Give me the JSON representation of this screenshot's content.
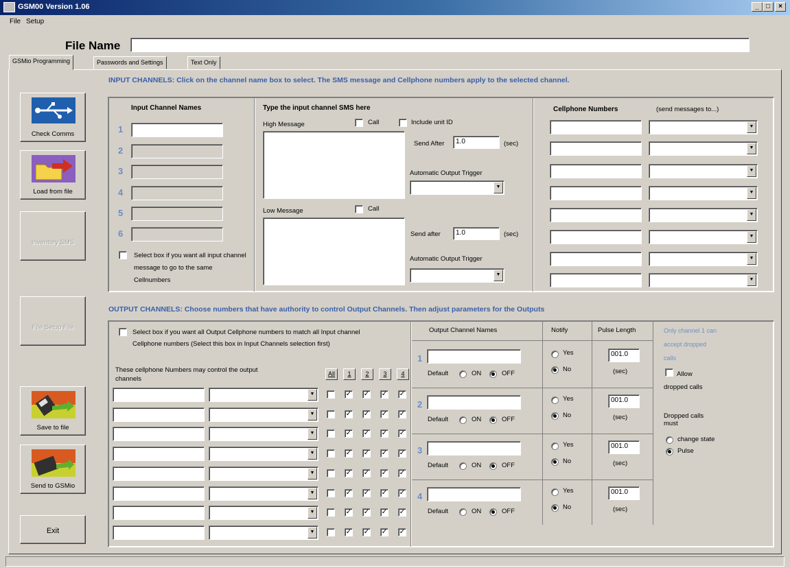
{
  "window": {
    "title": "GSM00 Version 1.06",
    "min": "_",
    "max": "□",
    "close": "×"
  },
  "menu": [
    "File",
    "Setup"
  ],
  "file_name_label": "File Name",
  "tabs": [
    "GSMio Programming",
    "Passwords and Settings",
    "Text Only"
  ],
  "left_buttons": {
    "check_comms": "Check Comms",
    "load_from_file": "Load from file",
    "inventory": "Inventory SMS",
    "file_setup": "File Setup File",
    "save_to_file": "Save to file",
    "send_to_gsmio": "Send to GSMio",
    "exit": "Exit"
  },
  "input": {
    "header": "INPUT CHANNELS: Click on the channel name box to select. The SMS message and Cellphone numbers apply to the selected channel.",
    "names_title": "Input Channel Names",
    "channel_numbers": [
      "1",
      "2",
      "3",
      "4",
      "5",
      "6"
    ],
    "select_all_text": "Select box if you want all input channel message to go to the same Cellnumbers",
    "sms_title": "Type the input channel SMS here",
    "high_message": "High Message",
    "low_message": "Low Message",
    "call": "Call",
    "include_unit_id": "Include unit ID",
    "send_after_high": "Send After",
    "send_after_low": "Send after",
    "send_after_value": "1.0",
    "sec": "(sec)",
    "auto_output_trigger": "Automatic Output Trigger",
    "cellphone_title": "Cellphone Numbers",
    "send_messages_to": "(send messages to...)"
  },
  "output": {
    "header": "OUTPUT CHANNELS: Choose numbers that have authority to control Output Channels. Then adjust parameters for the Outputs",
    "select_all_text": "Select box if you want all Output Cellphone numbers to match all Input channel Cellphone numbers (Select this box in Input Channels selection first)",
    "may_control": "These cellphone Numbers may control the output channels",
    "col_buttons": [
      "All",
      "1",
      "2",
      "3",
      "4"
    ],
    "channel_names_title": "Output Channel Names",
    "notify_title": "Notify",
    "pulse_title": "Pulse Length",
    "channel_numbers": [
      "1",
      "2",
      "3",
      "4"
    ],
    "default": "Default",
    "on": "ON",
    "off": "OFF",
    "yes": "Yes",
    "no": "No",
    "pulse_value": "001.0",
    "sec": "(sec)",
    "only_channel_note": "Only channel 1 can accept dropped calls",
    "allow_dropped": "Allow dropped calls",
    "dropped_must": "Dropped calls must",
    "change_state": "change state",
    "pulse": "Pulse"
  },
  "check_mark": "✓"
}
